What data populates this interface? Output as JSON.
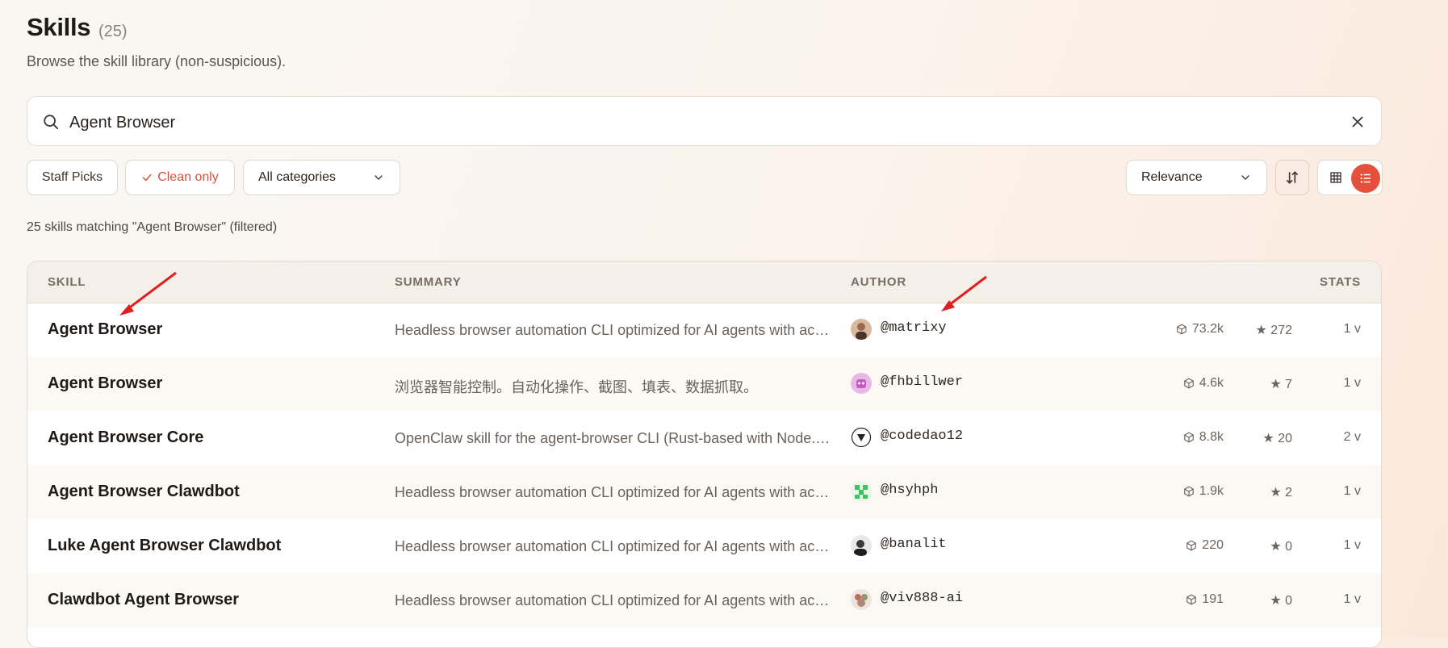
{
  "header": {
    "title": "Skills",
    "count": "(25)",
    "subtitle": "Browse the skill library (non-suspicious)."
  },
  "search": {
    "value": "Agent Browser",
    "icon": "search-icon",
    "clear_icon": "close-icon"
  },
  "filters": {
    "staff_picks": "Staff Picks",
    "clean_only": "Clean only",
    "categories": "All categories",
    "sort": "Relevance"
  },
  "result_text": "25 skills matching \"Agent Browser\" (filtered)",
  "table": {
    "headers": {
      "skill": "SKILL",
      "summary": "SUMMARY",
      "author": "AUTHOR",
      "stats": "STATS"
    },
    "rows": [
      {
        "name": "Agent Browser",
        "summary": "Headless browser automation CLI optimized for AI agents with accessibility tree snapshots and ref-based element selection",
        "author": "@matrixy",
        "downloads": "73.2k",
        "stars": "★ 272",
        "versions": "1 v"
      },
      {
        "name": "Agent Browser",
        "summary": "浏览器智能控制。自动化操作、截图、填表、数据抓取。",
        "author": "@fhbillwer",
        "downloads": "4.6k",
        "stars": "★ 7",
        "versions": "1 v"
      },
      {
        "name": "Agent Browser Core",
        "summary": "OpenClaw skill for the agent-browser CLI (Rust-based with Node.js fallback)",
        "author": "@codedao12",
        "downloads": "8.8k",
        "stars": "★ 20",
        "versions": "2 v"
      },
      {
        "name": "Agent Browser Clawdbot",
        "summary": "Headless browser automation CLI optimized for AI agents with accessibility tree snapshots",
        "author": "@hsyhph",
        "downloads": "1.9k",
        "stars": "★ 2",
        "versions": "1 v"
      },
      {
        "name": "Luke Agent Browser Clawdbot",
        "summary": "Headless browser automation CLI optimized for AI agents with accessibility tree snapshots",
        "author": "@banalit",
        "downloads": "220",
        "stars": "★ 0",
        "versions": "1 v"
      },
      {
        "name": "Clawdbot Agent Browser",
        "summary": "Headless browser automation CLI optimized for AI agents with accessibility tree snapshots",
        "author": "@viv888-ai",
        "downloads": "191",
        "stars": "★ 0",
        "versions": "1 v"
      }
    ]
  },
  "colors": {
    "accent": "#e4503c",
    "annotation": "#e02020"
  }
}
